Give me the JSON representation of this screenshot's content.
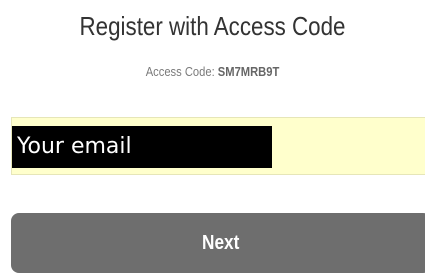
{
  "header": {
    "title": "Register with Access Code",
    "access_code_label": "Access Code: ",
    "access_code_value": "SM7MRB9T"
  },
  "form": {
    "email_placeholder": "Your email",
    "email_value": ""
  },
  "actions": {
    "next_label": "Next"
  },
  "colors": {
    "input_background": "#ffffcc",
    "button_background": "#6e6e6e",
    "button_text": "#ffffff",
    "title_text": "#333333"
  }
}
